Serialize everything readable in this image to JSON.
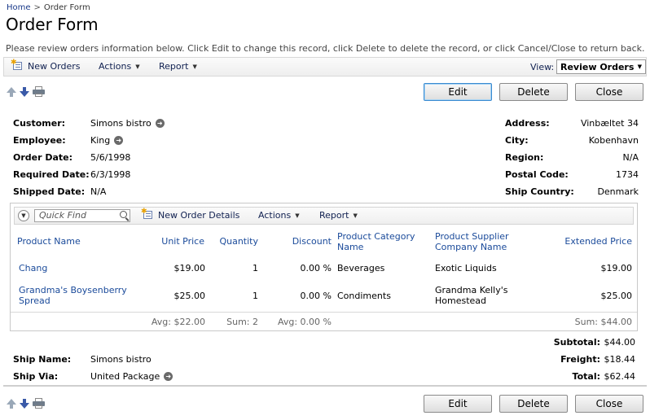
{
  "breadcrumb": {
    "home": "Home",
    "separator": ">",
    "current": "Order Form"
  },
  "page": {
    "title": "Order Form",
    "description": "Please review orders information below. Click Edit to change this record, click Delete to delete the record, or click Cancel/Close to return back."
  },
  "toolbar": {
    "new_orders": "New Orders",
    "actions": "Actions",
    "report": "Report",
    "view_label": "View:",
    "view_value": "Review Orders"
  },
  "buttons": {
    "edit": "Edit",
    "delete": "Delete",
    "close": "Close"
  },
  "order": {
    "customer_label": "Customer:",
    "customer": "Simons bistro",
    "employee_label": "Employee:",
    "employee": "King",
    "order_date_label": "Order Date:",
    "order_date": "5/6/1998",
    "required_date_label": "Required Date:",
    "required_date": "6/3/1998",
    "shipped_date_label": "Shipped Date:",
    "shipped_date": "N/A",
    "address_label": "Address:",
    "address": "Vinbæltet 34",
    "city_label": "City:",
    "city": "Kobenhavn",
    "region_label": "Region:",
    "region": "N/A",
    "postal_code_label": "Postal Code:",
    "postal_code": "1734",
    "ship_country_label": "Ship Country:",
    "ship_country": "Denmark",
    "ship_name_label": "Ship Name:",
    "ship_name": "Simons bistro",
    "ship_via_label": "Ship Via:",
    "ship_via": "United Package"
  },
  "details": {
    "quick_find_placeholder": "Quick Find",
    "new_order_details": "New Order Details",
    "actions": "Actions",
    "report": "Report",
    "columns": {
      "product_name": "Product Name",
      "unit_price": "Unit Price",
      "quantity": "Quantity",
      "discount": "Discount",
      "category_line1": "Product Category",
      "category_line2": "Name",
      "supplier_line1": "Product Supplier",
      "supplier_line2": "Company Name",
      "extended_price": "Extended Price"
    },
    "rows": [
      {
        "product_line1": "Chang",
        "product_line2": "",
        "unit_price": "$19.00",
        "quantity": "1",
        "discount": "0.00 %",
        "category": "Beverages",
        "supplier_line1": "Exotic Liquids",
        "supplier_line2": "",
        "extended_price": "$19.00"
      },
      {
        "product_line1": "Grandma's Boysenberry",
        "product_line2": "Spread",
        "unit_price": "$25.00",
        "quantity": "1",
        "discount": "0.00 %",
        "category": "Condiments",
        "supplier_line1": "Grandma Kelly's",
        "supplier_line2": "Homestead",
        "extended_price": "$25.00"
      }
    ],
    "footer": {
      "avg_price": "Avg: $22.00",
      "sum_qty": "Sum: 2",
      "avg_discount": "Avg: 0.00 %",
      "sum_ext": "Sum: $44.00"
    }
  },
  "totals": {
    "subtotal_label": "Subtotal:",
    "subtotal": "$44.00",
    "freight_label": "Freight:",
    "freight": "$18.44",
    "total_label": "Total:",
    "total": "$62.44"
  }
}
